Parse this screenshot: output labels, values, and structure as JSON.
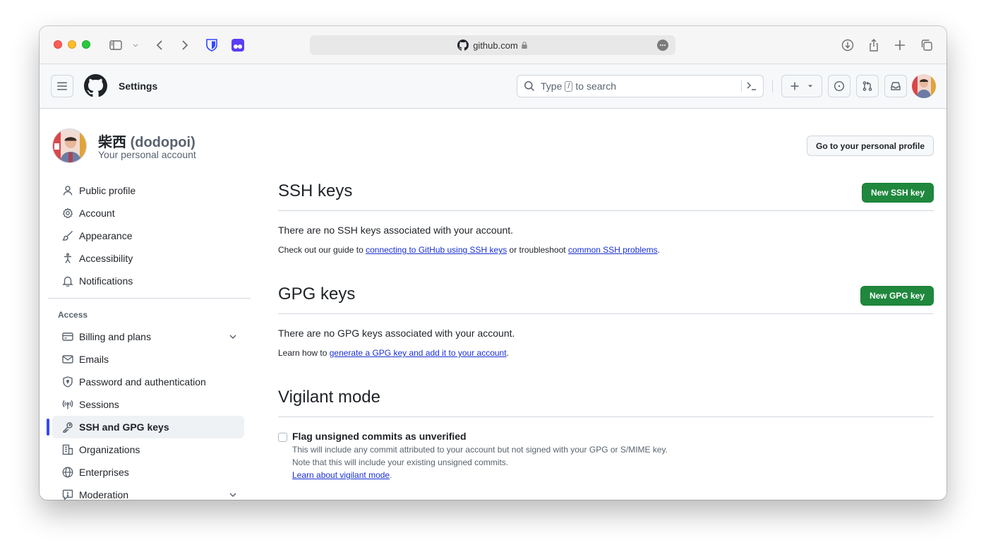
{
  "browser": {
    "url": "github.com",
    "colors": {
      "bitwarden": "#175DDC",
      "extension_purple": "#5b3df5"
    }
  },
  "header": {
    "title": "Settings",
    "search_prefix": "Type",
    "search_key": "/",
    "search_suffix": "to search"
  },
  "profile": {
    "display_name": "柴西",
    "handle": "(dodopoi)",
    "subtitle": "Your personal account",
    "go_to_profile_label": "Go to your personal profile"
  },
  "sidebar": {
    "top_items": [
      {
        "label": "Public profile",
        "icon": "person-icon"
      },
      {
        "label": "Account",
        "icon": "gear-icon"
      },
      {
        "label": "Appearance",
        "icon": "paintbrush-icon"
      },
      {
        "label": "Accessibility",
        "icon": "accessibility-icon"
      },
      {
        "label": "Notifications",
        "icon": "bell-icon"
      }
    ],
    "access_heading": "Access",
    "access_items": [
      {
        "label": "Billing and plans",
        "icon": "credit-card-icon"
      },
      {
        "label": "Emails",
        "icon": "mail-icon"
      },
      {
        "label": "Password and authentication",
        "icon": "shield-lock-icon"
      },
      {
        "label": "Sessions",
        "icon": "broadcast-icon"
      },
      {
        "label": "SSH and GPG keys",
        "icon": "key-icon"
      },
      {
        "label": "Organizations",
        "icon": "organization-icon"
      },
      {
        "label": "Enterprises",
        "icon": "globe-icon"
      },
      {
        "label": "Moderation",
        "icon": "report-icon"
      }
    ]
  },
  "ssh": {
    "title": "SSH keys",
    "button": "New SSH key",
    "empty_text": "There are no SSH keys associated with your account.",
    "help_prefix": "Check out our guide to",
    "help_link1": "connecting to GitHub using SSH keys",
    "help_middle": "or troubleshoot",
    "help_link2": "common SSH problems",
    "help_suffix": "."
  },
  "gpg": {
    "title": "GPG keys",
    "button": "New GPG key",
    "empty_text": "There are no GPG keys associated with your account.",
    "help_prefix": "Learn how to",
    "help_link": "generate a GPG key and add it to your account",
    "help_suffix": "."
  },
  "vigilant": {
    "title": "Vigilant mode",
    "checkbox_label": "Flag unsigned commits as unverified",
    "checked": false,
    "desc_line1": "This will include any commit attributed to your account but not signed with your GPG or S/MIME key.",
    "desc_line2": "Note that this will include your existing unsigned commits.",
    "learn_link": "Learn about vigilant mode",
    "learn_suffix": "."
  },
  "colors": {
    "primary_button": "#1f883d",
    "link": "#1a30d4",
    "active_indicator": "#3348ff"
  }
}
